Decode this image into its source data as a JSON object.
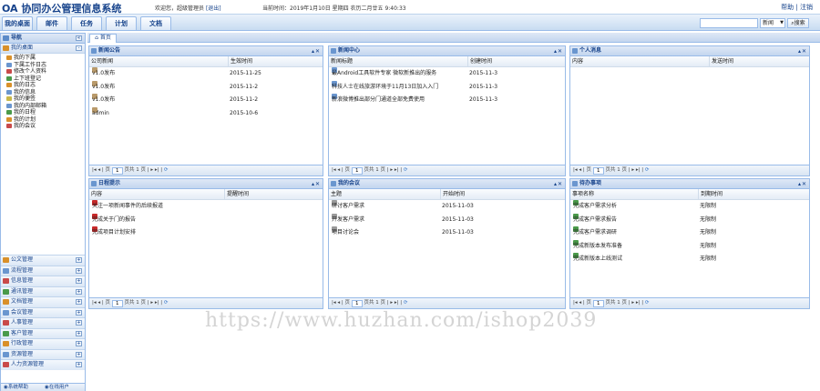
{
  "header": {
    "app_title": "OA 协同办公管理信息系统",
    "user_label": "欢迎您，超级管理员",
    "logout_link": "[退出]",
    "time_text": "当前时间：2019年1月10日  星期四  农历二月廿五  9:40:33",
    "help_link": "帮助",
    "separator": "|",
    "exit_link": "注销"
  },
  "nav": {
    "tabs": [
      {
        "label": "我的桌面"
      },
      {
        "label": "邮件"
      },
      {
        "label": "任务"
      },
      {
        "label": "计划"
      },
      {
        "label": "文档"
      }
    ],
    "search": {
      "select_value": "新闻",
      "button_label": "搜索"
    }
  },
  "sidebar": {
    "title": "导航",
    "group_open": "我的桌面",
    "tree": [
      {
        "label": "我的下属",
        "color": "#d9902a"
      },
      {
        "label": "下属工作日志",
        "color": "#6a96cf"
      },
      {
        "label": "修改个人资料",
        "color": "#c94a4a"
      },
      {
        "label": "上下班登记",
        "color": "#4a9a4a"
      },
      {
        "label": "我的日志",
        "color": "#d9902a"
      },
      {
        "label": "我的信息",
        "color": "#6a96cf"
      },
      {
        "label": "我的便签",
        "color": "#c9b84a"
      },
      {
        "label": "我的内部邮箱",
        "color": "#6a96cf"
      },
      {
        "label": "我的日程",
        "color": "#4a9a4a"
      },
      {
        "label": "我的计划",
        "color": "#d9902a"
      },
      {
        "label": "我的会议",
        "color": "#c94a4a"
      }
    ],
    "groups": [
      {
        "label": "公文管理",
        "color": "#d9902a"
      },
      {
        "label": "流程管理",
        "color": "#6a96cf"
      },
      {
        "label": "信息管理",
        "color": "#c94a4a"
      },
      {
        "label": "通讯管理",
        "color": "#4a9a4a"
      },
      {
        "label": "文档管理",
        "color": "#d9902a"
      },
      {
        "label": "会议管理",
        "color": "#6a96cf"
      },
      {
        "label": "人事管理",
        "color": "#c94a4a"
      },
      {
        "label": "客户管理",
        "color": "#4a9a4a"
      },
      {
        "label": "行政管理",
        "color": "#d9902a"
      },
      {
        "label": "资源管理",
        "color": "#6a96cf"
      },
      {
        "label": "人力资源管理",
        "color": "#c94a4a"
      }
    ],
    "footer": {
      "left": "系统帮助",
      "right": "在线用户"
    }
  },
  "main": {
    "home_tab": "首页",
    "panels": [
      {
        "title": "新闻公告",
        "columns": [
          "公司新闻",
          "生效时间"
        ],
        "rows": [
          {
            "c1": "v1.0发布",
            "c2": "2015-11-25",
            "color": "#b99a6a"
          },
          {
            "c1": "v1.0发布",
            "c2": "2015-11-2",
            "color": "#b99a6a"
          },
          {
            "c1": "v1.0发布",
            "c2": "2015-11-2",
            "color": "#b99a6a"
          },
          {
            "c1": "admin",
            "c2": "2015-10-6",
            "color": "#b99a6a"
          }
        ],
        "pager": {
          "text1": "页",
          "page": "1",
          "text2": "页共 1 页"
        }
      },
      {
        "title": "新闻中心",
        "columns": [
          "新闻标题",
          "创建时间"
        ],
        "rows": [
          {
            "c1": "最Android工具软件专家 微软新推出的服务",
            "c2": "2015-11-3",
            "color": "#6a96cf"
          },
          {
            "c1": "科技人士在线旅游环境于11月13日加入入门",
            "c2": "2015-11-3",
            "color": "#6a96cf"
          },
          {
            "c1": "新浪微博推出部分门通道全部免费使用",
            "c2": "2015-11-3",
            "color": "#6a96cf"
          }
        ],
        "pager": {
          "text1": "页",
          "page": "1",
          "text2": "页共 1 页"
        }
      },
      {
        "title": "个人消息",
        "columns": [
          "内容",
          "发送时间"
        ],
        "rows": [],
        "pager": {
          "text1": "页",
          "page": "1",
          "text2": "页共 1 页"
        }
      },
      {
        "title": "日程提示",
        "columns": [
          "内容",
          "提醒时间"
        ],
        "rows": [
          {
            "c1": "关注一项新闻事件的后续报道",
            "c2": "",
            "color": "#c92a2a"
          },
          {
            "c1": "完成关于门的报告",
            "c2": "",
            "color": "#c92a2a"
          },
          {
            "c1": "完成项目计划安排",
            "c2": "",
            "color": "#c92a2a"
          }
        ],
        "pager": {
          "text1": "页",
          "page": "1",
          "text2": "页共 1 页"
        }
      },
      {
        "title": "我的会议",
        "columns": [
          "主题",
          "开始时间"
        ],
        "rows": [
          {
            "c1": "研讨客户需求",
            "c2": "2015-11-03",
            "color": "#9a9a9a"
          },
          {
            "c1": "开发客户需求",
            "c2": "2015-11-03",
            "color": "#9a9a9a"
          },
          {
            "c1": "项目讨论会",
            "c2": "2015-11-03",
            "color": "#9a9a9a"
          }
        ],
        "pager": {
          "text1": "页",
          "page": "1",
          "text2": "页共 1 页"
        }
      },
      {
        "title": "待办事项",
        "columns": [
          "事项名称",
          "到期时间"
        ],
        "rows": [
          {
            "c1": "完成客户需求分析",
            "c2": "无限制",
            "color": "#4a9a4a"
          },
          {
            "c1": "完成客户需求报告",
            "c2": "无限制",
            "color": "#4a9a4a"
          },
          {
            "c1": "完成客户需求调研",
            "c2": "无限制",
            "color": "#4a9a4a"
          },
          {
            "c1": "完成新版本发布准备",
            "c2": "无限制",
            "color": "#4a9a4a"
          },
          {
            "c1": "完成新版本上线测试",
            "c2": "无限制",
            "color": "#4a9a4a"
          }
        ],
        "pager": {
          "text1": "页",
          "page": "1",
          "text2": "页共 1 页"
        }
      }
    ]
  },
  "watermark": "https://www.huzhan.com/ishop2039"
}
